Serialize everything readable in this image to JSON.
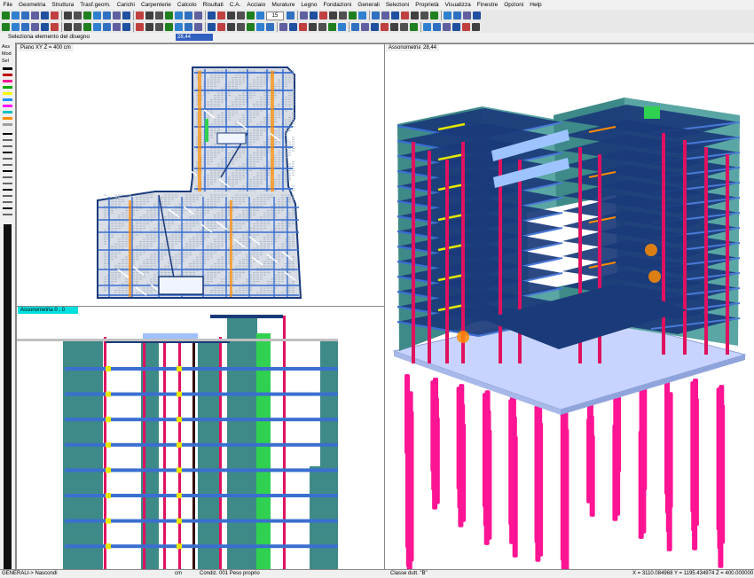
{
  "menu": [
    "File",
    "Geometria",
    "Struttura",
    "Trasf.geom.",
    "Carichi",
    "Carpenterie",
    "Calcolo",
    "Risultati",
    "C.A.",
    "Acciaio",
    "Murature",
    "Legno",
    "Fondazioni",
    "Generali",
    "Selezioni",
    "Proprietà",
    "Visualizza",
    "Finestre",
    "Opzioni",
    "Help"
  ],
  "toolbar": {
    "zoom_value": "15"
  },
  "prompt": {
    "text": "Seleziona  elemento del disegno",
    "value": "28,44"
  },
  "left_panel": {
    "labels": [
      "Ass",
      "Mod",
      "Sel"
    ],
    "swatch_colors": [
      "#000000",
      "#c00000",
      "#ff1493",
      "#00aa00",
      "#ffff00",
      "#1e90ff",
      "#ff00ff",
      "#00c0c0",
      "#ff8c00",
      "#a0a0a0"
    ]
  },
  "viewports": {
    "plan": {
      "title": "Piano XY  Z = 400 cm"
    },
    "axo_right": {
      "title": "Assonometria",
      "value": "28,44"
    },
    "axo_left": {
      "title": "Assonometria   0 , 0"
    }
  },
  "status": {
    "mode": "GENERALI-> Nascondi",
    "unit": "cm",
    "condition": "Condiz. 001  Peso proprio",
    "class": "Classe dutt. \"B\"",
    "coords": "X = 3110.084968 Y = 1195.434974 Z = 400.000000"
  },
  "colors": {
    "slab": "#1a3a7a",
    "column": "#e0115f",
    "wall": "#3e8a88",
    "beam": "#3a6fd0",
    "pile": "#ff1493",
    "base": "#c8d4ff",
    "yellow": "#e6e600",
    "orange": "#ff8c00",
    "green": "#30d050"
  }
}
